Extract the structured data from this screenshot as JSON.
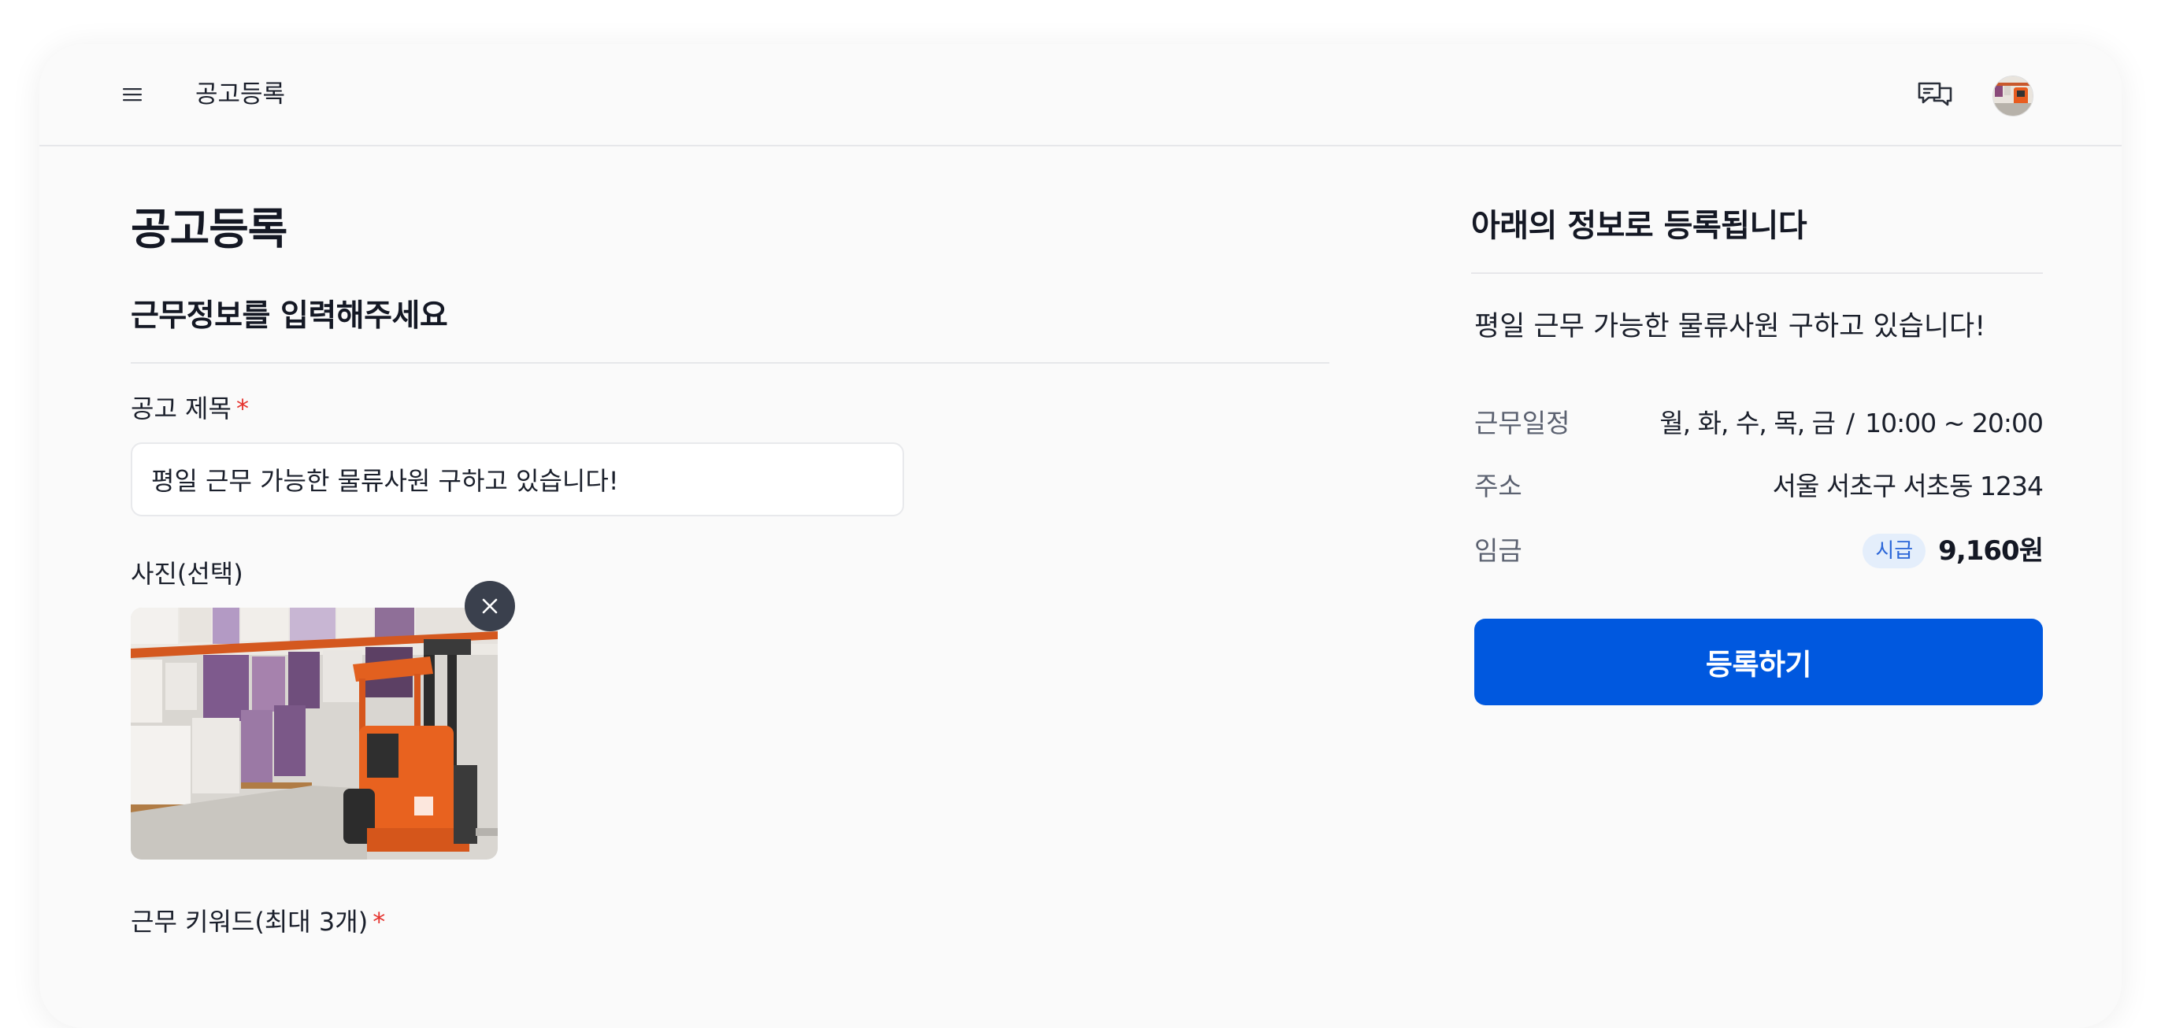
{
  "header": {
    "title": "공고등록",
    "menu_icon": "hamburger-menu-icon",
    "chat_icon": "chat-bubbles-icon",
    "avatar": "user-avatar"
  },
  "form": {
    "page_title": "공고등록",
    "section_title": "근무정보를 입력해주세요",
    "title_field": {
      "label": "공고 제목",
      "required_mark": "*",
      "value": "평일 근무 가능한 물류사원 구하고 있습니다!"
    },
    "photo_field": {
      "label": "사진(선택)",
      "remove_icon": "close-icon"
    },
    "keyword_field": {
      "label": "근무 키워드(최대 3개)",
      "required_mark": "*"
    }
  },
  "summary": {
    "title": "아래의 정보로 등록됩니다",
    "post_title": "평일 근무 가능한 물류사원 구하고 있습니다!",
    "schedule": {
      "label": "근무일정",
      "days": "월, 화, 수, 목, 금",
      "separator": "/",
      "hours": "10:00 ~ 20:00"
    },
    "address": {
      "label": "주소",
      "value": "서울 서초구 서초동 1234"
    },
    "wage": {
      "label": "임금",
      "type": "시급",
      "amount": "9,160원"
    },
    "submit_label": "등록하기"
  },
  "colors": {
    "primary": "#0058df",
    "required": "#e5322d",
    "badge_bg": "#e4eefb",
    "badge_text": "#2b66d8"
  }
}
